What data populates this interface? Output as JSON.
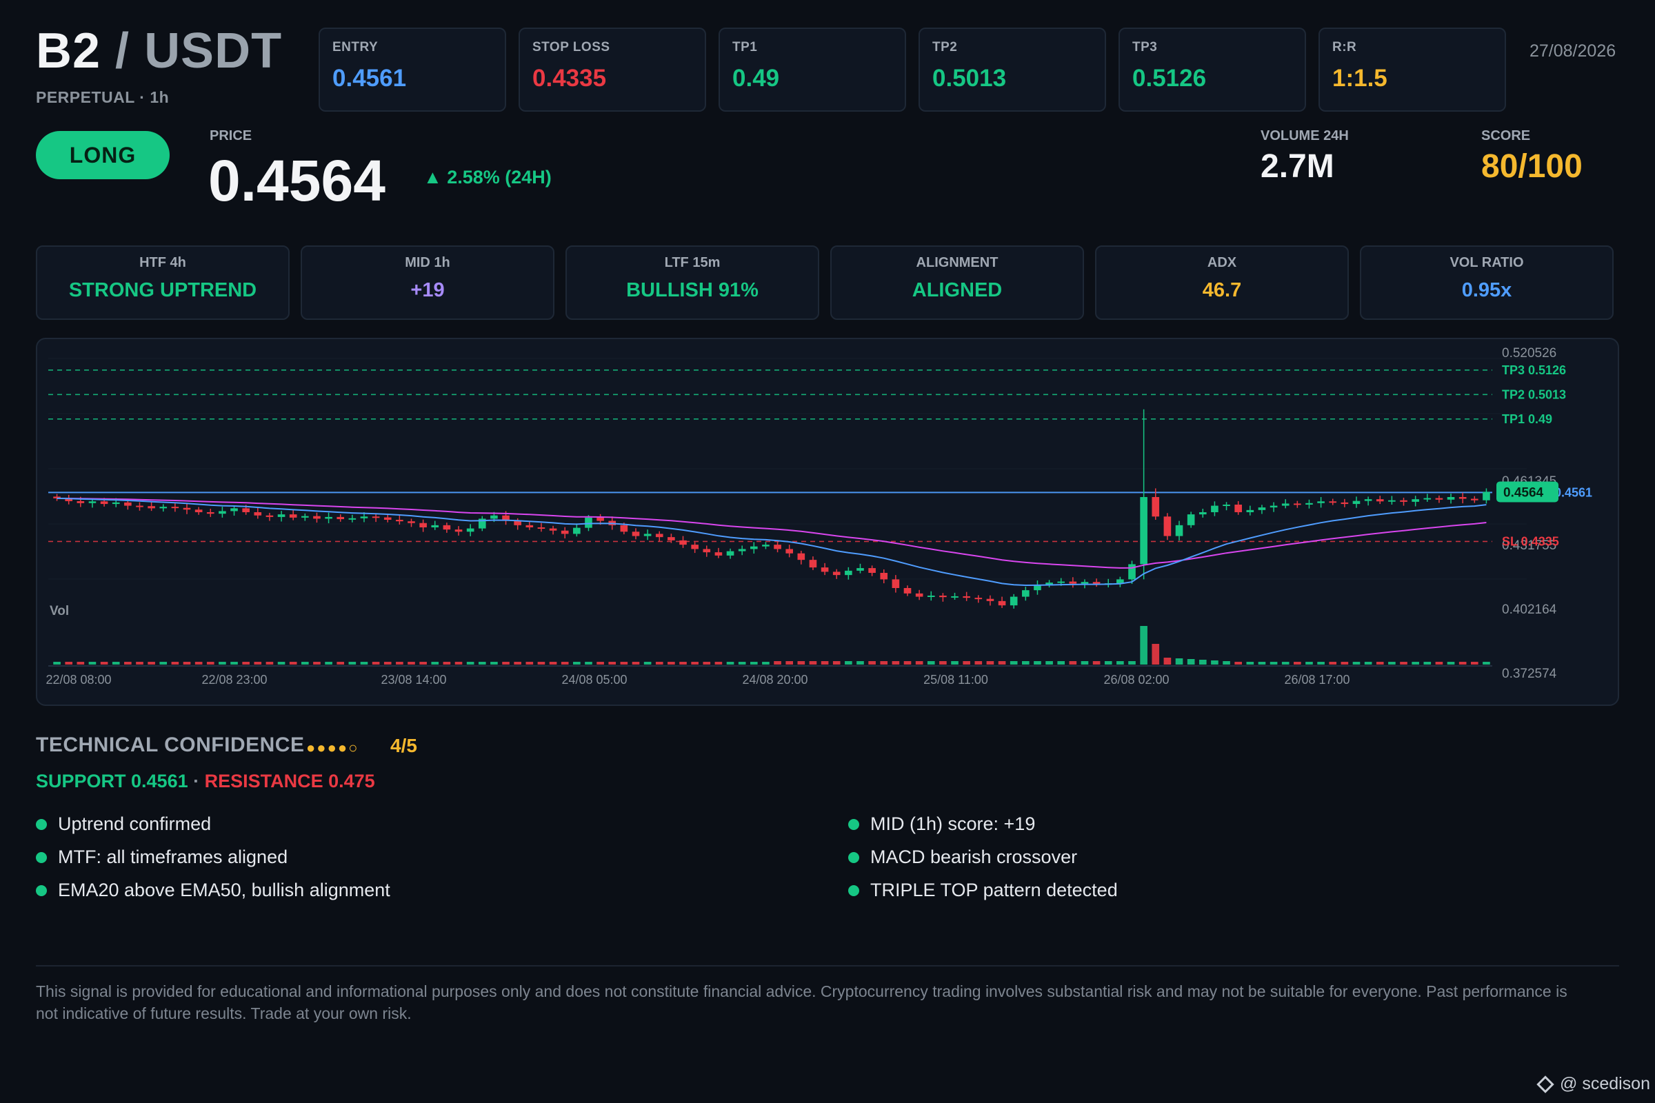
{
  "header": {
    "base": "B2",
    "separator": " / ",
    "quote": "USDT",
    "subtitle": "PERPETUAL · 1h",
    "date": "27/08/2026"
  },
  "stats": [
    {
      "label": "ENTRY",
      "value": "0.4561",
      "color": "#4f9dff"
    },
    {
      "label": "STOP LOSS",
      "value": "0.4335",
      "color": "#ea3943"
    },
    {
      "label": "TP1",
      "value": "0.49",
      "color": "#16c784"
    },
    {
      "label": "TP2",
      "value": "0.5013",
      "color": "#16c784"
    },
    {
      "label": "TP3",
      "value": "0.5126",
      "color": "#16c784"
    },
    {
      "label": "R:R",
      "value": "1:1.5",
      "color": "#f5b82e"
    }
  ],
  "signal": {
    "direction": "LONG",
    "price_label": "PRICE",
    "price": "0.4564",
    "change": "▲ 2.58% (24H)",
    "volume_label": "VOLUME 24H",
    "volume": "2.7M",
    "score_label": "SCORE",
    "score": "80/100"
  },
  "indicators": [
    {
      "label": "HTF 4h",
      "value": "STRONG UPTREND",
      "color": "#16c784"
    },
    {
      "label": "MID 1h",
      "value": "+19",
      "color": "#a78bfa"
    },
    {
      "label": "LTF 15m",
      "value": "BULLISH 91%",
      "color": "#16c784"
    },
    {
      "label": "ALIGNMENT",
      "value": "ALIGNED",
      "color": "#16c784"
    },
    {
      "label": "ADX",
      "value": "46.7",
      "color": "#f5b82e"
    },
    {
      "label": "VOL RATIO",
      "value": "0.95x",
      "color": "#4f9dff"
    }
  ],
  "chart_data": {
    "type": "candlestick",
    "y_ticks": [
      "0.520526",
      "0.461345",
      "0.431755",
      "0.402164",
      "0.372574"
    ],
    "y_tick_values": [
      0.520526,
      0.461345,
      0.431755,
      0.402164,
      0.372574
    ],
    "x_labels": [
      "22/08 08:00",
      "22/08 23:00",
      "23/08 14:00",
      "24/08 05:00",
      "24/08 20:00",
      "25/08 11:00",
      "26/08 02:00",
      "26/08 17:00"
    ],
    "levels": [
      {
        "label": "TP3 0.5126",
        "value": 0.5126,
        "color": "#16c784"
      },
      {
        "label": "TP2 0.5013",
        "value": 0.5013,
        "color": "#16c784"
      },
      {
        "label": "TP1 0.49",
        "value": 0.49,
        "color": "#16c784"
      },
      {
        "label": "0.4561",
        "value": 0.4561,
        "color": "#4f9dff"
      },
      {
        "label": "SL 0.4335",
        "value": 0.4335,
        "color": "#ea3943"
      }
    ],
    "last_price_label": "0.4564",
    "last_price": 0.4564,
    "volume_label": "Vol",
    "close_series": [
      0.4534,
      0.4521,
      0.4512,
      0.452,
      0.4508,
      0.4515,
      0.45,
      0.4498,
      0.4488,
      0.4495,
      0.449,
      0.4482,
      0.447,
      0.4463,
      0.4475,
      0.4488,
      0.447,
      0.4455,
      0.4448,
      0.446,
      0.4445,
      0.4452,
      0.444,
      0.4448,
      0.4438,
      0.4442,
      0.445,
      0.4446,
      0.4435,
      0.4428,
      0.442,
      0.44,
      0.441,
      0.439,
      0.438,
      0.4395,
      0.444,
      0.4455,
      0.443,
      0.441,
      0.44,
      0.4395,
      0.4385,
      0.437,
      0.4398,
      0.4445,
      0.443,
      0.441,
      0.438,
      0.436,
      0.437,
      0.4355,
      0.434,
      0.432,
      0.43,
      0.4285,
      0.427,
      0.429,
      0.43,
      0.4312,
      0.432,
      0.43,
      0.428,
      0.425,
      0.4215,
      0.4195,
      0.418,
      0.42,
      0.4212,
      0.419,
      0.416,
      0.412,
      0.4095,
      0.408,
      0.4085,
      0.4078,
      0.4082,
      0.4075,
      0.407,
      0.406,
      0.404,
      0.408,
      0.411,
      0.4135,
      0.4145,
      0.415,
      0.414,
      0.4148,
      0.4138,
      0.4142,
      0.416,
      0.423,
      0.454,
      0.445,
      0.436,
      0.441,
      0.446,
      0.447,
      0.45,
      0.4505,
      0.447,
      0.448,
      0.4492,
      0.45,
      0.451,
      0.4505,
      0.4512,
      0.452,
      0.4515,
      0.4508,
      0.4522,
      0.453,
      0.452,
      0.4525,
      0.4518,
      0.453,
      0.4535,
      0.4528,
      0.454,
      0.4532,
      0.4525,
      0.4564
    ],
    "ema20_color": "#4f9dff",
    "ema50_color": "#d946ef",
    "up_color": "#16c784",
    "down_color": "#ea3943"
  },
  "confidence": {
    "title": "TECHNICAL CONFIDENCE",
    "dots": "●●●●○",
    "score": "4/5",
    "support": "SUPPORT 0.4561",
    "separator": " · ",
    "resistance": "RESISTANCE 0.475"
  },
  "reasons_left": [
    "Uptrend confirmed",
    "MTF: all timeframes aligned",
    "EMA20 above EMA50, bullish alignment"
  ],
  "reasons_right": [
    "MID (1h) score: +19",
    "MACD bearish crossover",
    "TRIPLE TOP pattern detected"
  ],
  "disclaimer": "This signal is provided for educational and informational purposes only and does not constitute financial advice. Cryptocurrency trading involves substantial risk and may not be suitable for everyone. Past performance is not indicative of future results. Trade at your own risk.",
  "watermark": "@ scedison"
}
